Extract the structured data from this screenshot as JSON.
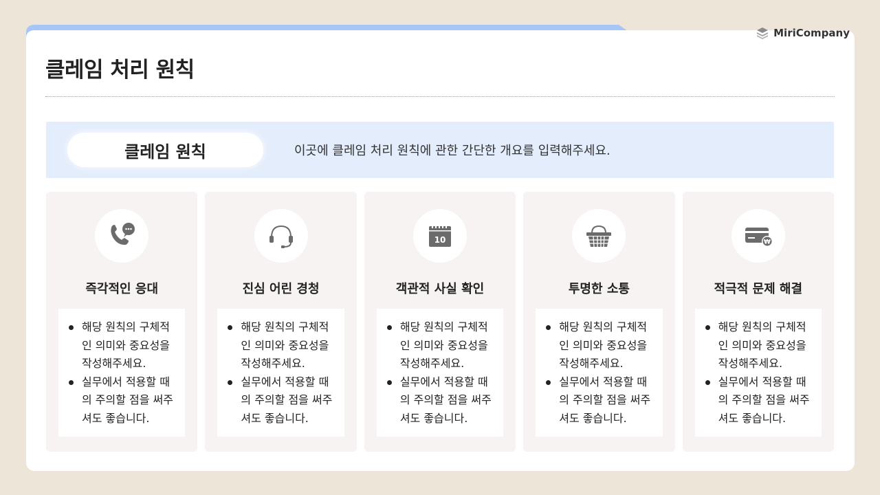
{
  "logo": {
    "text": "MiriCompany",
    "icon": "stacked-layers-icon"
  },
  "page_title": "클레임 처리 원칙",
  "banner": {
    "label": "클레임 원칙",
    "description": "이곳에 클레임 처리 원칙에 관한 간단한 개요를 입력해주세요."
  },
  "columns": [
    {
      "icon": "phone-chat-icon",
      "title": "즉각적인 응대",
      "bullets": [
        "해당 원칙의 구체적인 의미와 중요성을 작성해주세요.",
        "실무에서 적용할 때의 주의할 점을 써주셔도 좋습니다."
      ]
    },
    {
      "icon": "headset-icon",
      "title": "진심 어린 경청",
      "bullets": [
        "해당 원칙의 구체적인 의미와 중요성을 작성해주세요.",
        "실무에서 적용할 때의 주의할 점을 써주셔도 좋습니다."
      ]
    },
    {
      "icon": "calendar-icon",
      "calendar_day": "10",
      "title": "객관적 사실 확인",
      "bullets": [
        "해당 원칙의 구체적인 의미와 중요성을 작성해주세요.",
        "실무에서 적용할 때의 주의할 점을 써주셔도 좋습니다."
      ]
    },
    {
      "icon": "basket-icon",
      "title": "투명한 소통",
      "bullets": [
        "해당 원칙의 구체적인 의미와 중요성을 작성해주세요.",
        "실무에서 적용할 때의 주의할 점을 써주셔도 좋습니다."
      ]
    },
    {
      "icon": "card-won-icon",
      "title": "적극적 문제 해결",
      "bullets": [
        "해당 원칙의 구체적인 의미와 중요성을 작성해주세요.",
        "실무에서 적용할 때의 주의할 점을 써주셔도 좋습니다."
      ]
    }
  ],
  "colors": {
    "background": "#ede6d8",
    "accent_blue": "#a7c6f7",
    "banner_bg": "#e4edfb",
    "column_bg": "#f6f3f2",
    "icon_gray": "#6b6b6b"
  }
}
